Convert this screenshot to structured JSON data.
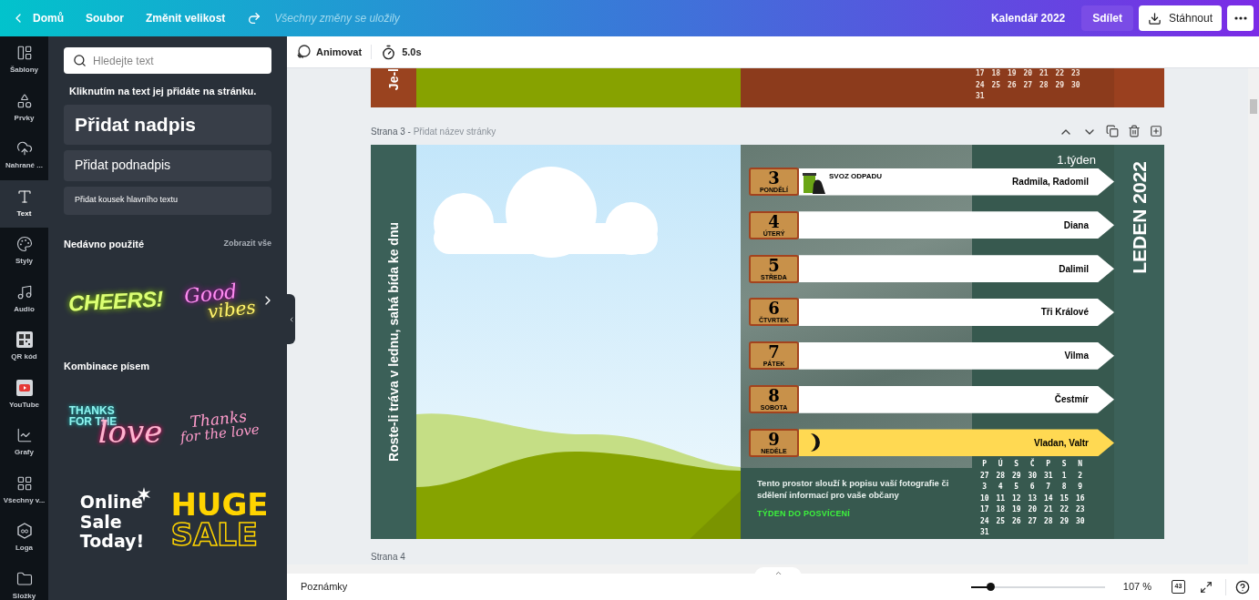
{
  "topbar": {
    "back": "Domů",
    "menu": [
      "Soubor",
      "Změnit velikost"
    ],
    "save_status": "Všechny změny se uložily",
    "document_title": "Kalendář 2022",
    "share": "Sdílet",
    "download": "Stáhnout"
  },
  "rail": [
    {
      "kind": "templates",
      "label": "Šablony",
      "selected": false
    },
    {
      "kind": "elements",
      "label": "Prvky",
      "selected": false
    },
    {
      "kind": "uploads",
      "label": "Nahrané ...",
      "selected": false
    },
    {
      "kind": "text",
      "label": "Text",
      "selected": true
    },
    {
      "kind": "styles",
      "label": "Styly",
      "selected": false
    },
    {
      "kind": "audio",
      "label": "Audio",
      "selected": false
    },
    {
      "kind": "qr",
      "label": "QR kód",
      "selected": false
    },
    {
      "kind": "youtube",
      "label": "YouTube",
      "selected": false
    },
    {
      "kind": "charts",
      "label": "Grafy",
      "selected": false
    },
    {
      "kind": "apps",
      "label": "Všechny v...",
      "selected": false
    },
    {
      "kind": "logos",
      "label": "Loga",
      "selected": false
    },
    {
      "kind": "folders",
      "label": "Složky",
      "selected": false
    }
  ],
  "panel": {
    "search_placeholder": "Hledejte text",
    "hint": "Kliknutím na text jej přidáte na stránku.",
    "text_buttons": [
      {
        "kind": "heading",
        "label": "Přidat nadpis"
      },
      {
        "kind": "subheading",
        "label": "Přidat podnadpis"
      },
      {
        "kind": "body",
        "label": "Přidat kousek hlavního textu"
      }
    ],
    "recent": {
      "title": "Nedávno použité",
      "see_all": "Zobrazit vše",
      "items": [
        {
          "kind": "neon-cheers",
          "lines": [
            "CHEERS!"
          ]
        },
        {
          "kind": "neon-vibes",
          "lines": [
            "Good",
            "vibes"
          ]
        }
      ]
    },
    "combos": {
      "title": "Kombinace písem",
      "items": [
        {
          "kind": "neon-thanks",
          "lines": [
            "THANKS",
            "FOR THE",
            "love"
          ]
        },
        {
          "kind": "script-thanks",
          "lines": [
            "Thanks",
            "for the love"
          ]
        },
        {
          "kind": "sale-today",
          "lines": [
            "Online",
            "Sale",
            "Today!"
          ]
        },
        {
          "kind": "huge-sale",
          "lines": [
            "HUGE",
            "SALE"
          ]
        }
      ]
    }
  },
  "toolbar": {
    "animate": "Animovat",
    "duration": "5.0s"
  },
  "page2": {
    "side_text": "Je-l",
    "calendar_rows": [
      [
        "17",
        "18",
        "19",
        "20",
        "21",
        "22",
        "23"
      ],
      [
        "24",
        "25",
        "26",
        "27",
        "28",
        "29",
        "30"
      ],
      [
        "31"
      ]
    ]
  },
  "page3": {
    "page_label": "Strana 3 -",
    "page_title_placeholder": "Přidat název stránky",
    "side_text": "Roste-li tráva v lednu, sahá bída ke dnu",
    "week_label": "1.týden",
    "month_title": "LEDEN 2022",
    "days": [
      {
        "day": "3",
        "weekday": "PONDĚLÍ",
        "name": "Radmila, Radomil",
        "highlight": false,
        "marker": {
          "kind": "trash",
          "label": "SVOZ ODPADU"
        }
      },
      {
        "day": "4",
        "weekday": "ÚTERÝ",
        "name": "Diana",
        "highlight": false
      },
      {
        "day": "5",
        "weekday": "STŘEDA",
        "name": "Dalimil",
        "highlight": false
      },
      {
        "day": "6",
        "weekday": "ČTVRTEK",
        "name": "Tři Králové",
        "highlight": false
      },
      {
        "day": "7",
        "weekday": "PÁTEK",
        "name": "Vilma",
        "highlight": false
      },
      {
        "day": "8",
        "weekday": "SOBOTA",
        "name": "Čestmír",
        "highlight": false
      },
      {
        "day": "9",
        "weekday": "NEDĚLE",
        "name": "Vladan, Valtr",
        "highlight": true,
        "marker": {
          "kind": "moon"
        }
      }
    ],
    "description": "Tento prostor slouží k popisu vaší fotografie či sdělení informací pro vaše občany",
    "highlight_text": "TÝDEN DO POSVÍCENÍ",
    "calendar_header": [
      "P",
      "Ú",
      "S",
      "Č",
      "P",
      "S",
      "N"
    ],
    "calendar_rows": [
      [
        "27",
        "28",
        "29",
        "30",
        "31",
        "1",
        "2"
      ],
      [
        "3",
        "4",
        "5",
        "6",
        "7",
        "8",
        "9"
      ],
      [
        "10",
        "11",
        "12",
        "13",
        "14",
        "15",
        "16"
      ],
      [
        "17",
        "18",
        "19",
        "20",
        "21",
        "22",
        "23"
      ],
      [
        "24",
        "25",
        "26",
        "27",
        "28",
        "29",
        "30"
      ],
      [
        "31"
      ]
    ]
  },
  "next_page_label": "Strana 4",
  "bottombar": {
    "notes": "Poznámky",
    "zoom": {
      "level": 0.15,
      "reading": "107 %"
    },
    "page_count": "43"
  }
}
